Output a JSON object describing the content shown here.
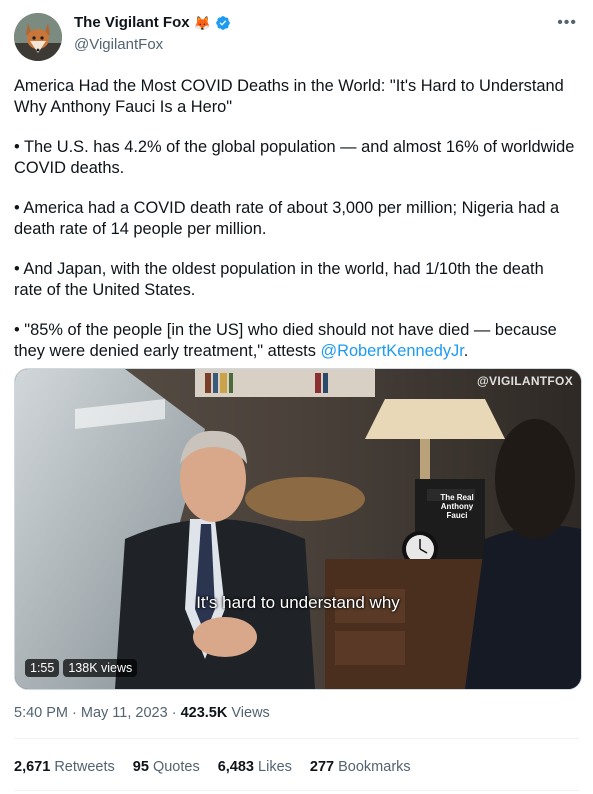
{
  "author": {
    "display_name": "The Vigilant Fox",
    "emoji": "🦊",
    "handle": "@VigilantFox",
    "avatar_icon": "fox-avatar-icon",
    "verified_color": "#1d9bf0"
  },
  "more_icon": "•••",
  "tweet": {
    "headline": "America Had the Most COVID Deaths in the World: \"It's Hard to Understand Why Anthony Fauci Is a Hero\"",
    "bullet1": "• The U.S. has 4.2% of the global population — and almost 16% of worldwide COVID deaths.",
    "bullet2": "• America had a COVID death rate of about 3,000 per million; Nigeria had a death rate of 14 people per million.",
    "bullet3": "• And Japan, with the oldest population in the world, had 1/10th the death rate of the United States.",
    "bullet4_text": "• \"85% of the people [in the US] who died should not have died — because they were denied early treatment,\" attests ",
    "bullet4_mention": "@RobertKennedyJr",
    "bullet4_end": "."
  },
  "video": {
    "watermark": "@VIGILANTFOX",
    "caption": "It's hard to understand why",
    "duration": "1:55",
    "views": "138K views",
    "book_title": "The Real Anthony Fauci"
  },
  "meta": {
    "time": "5:40 PM",
    "sep": " · ",
    "date": "May 11, 2023",
    "views_count": "423.5K",
    "views_label": " Views"
  },
  "stats": {
    "retweets_count": "2,671",
    "retweets_label": " Retweets",
    "quotes_count": "95",
    "quotes_label": " Quotes",
    "likes_count": "6,483",
    "likes_label": " Likes",
    "bookmarks_count": "277",
    "bookmarks_label": " Bookmarks"
  },
  "colors": {
    "link": "#1d9bf0",
    "secondary_text": "#536471",
    "primary_text": "#0f1419"
  }
}
